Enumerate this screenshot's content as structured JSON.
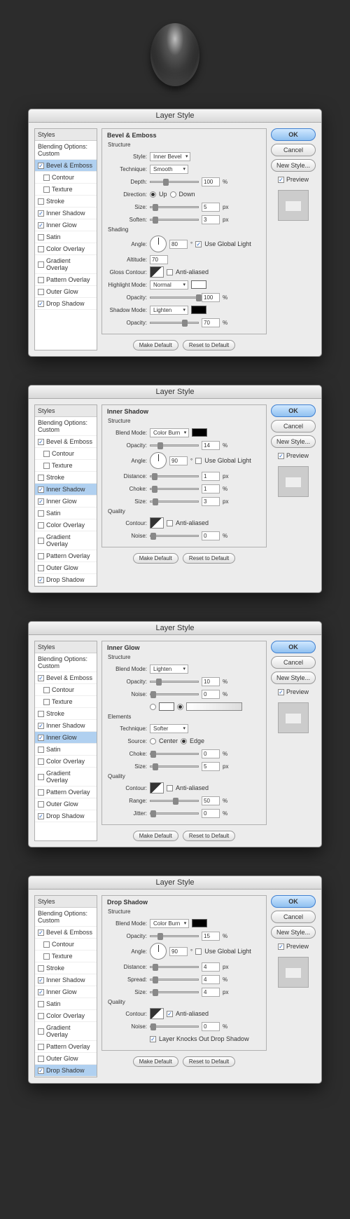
{
  "dialog_title": "Layer Style",
  "buttons": {
    "ok": "OK",
    "cancel": "Cancel",
    "new_style": "New Style...",
    "preview": "Preview",
    "make_default": "Make Default",
    "reset_default": "Reset to Default"
  },
  "styles_panel": {
    "header": "Styles",
    "blending": "Blending Options: Custom",
    "items": [
      {
        "label": "Bevel & Emboss",
        "checked": true
      },
      {
        "label": "Contour",
        "checked": false,
        "indent": true
      },
      {
        "label": "Texture",
        "checked": false,
        "indent": true
      },
      {
        "label": "Stroke",
        "checked": false
      },
      {
        "label": "Inner Shadow",
        "checked": true
      },
      {
        "label": "Inner Glow",
        "checked": true
      },
      {
        "label": "Satin",
        "checked": false
      },
      {
        "label": "Color Overlay",
        "checked": false
      },
      {
        "label": "Gradient Overlay",
        "checked": false
      },
      {
        "label": "Pattern Overlay",
        "checked": false
      },
      {
        "label": "Outer Glow",
        "checked": false
      },
      {
        "label": "Drop Shadow",
        "checked": true
      }
    ]
  },
  "panels": [
    {
      "title": "Bevel & Emboss",
      "selected": "Bevel & Emboss",
      "sections": [
        {
          "title": "Structure",
          "rows": [
            {
              "type": "select",
              "label": "Style:",
              "value": "Inner Bevel"
            },
            {
              "type": "select",
              "label": "Technique:",
              "value": "Smooth"
            },
            {
              "type": "slider",
              "label": "Depth:",
              "value": "100",
              "unit": "%",
              "pos": 18
            },
            {
              "type": "radio2",
              "label": "Direction:",
              "opt1": "Up",
              "opt2": "Down",
              "sel": 1
            },
            {
              "type": "slider",
              "label": "Size:",
              "value": "5",
              "unit": "px",
              "pos": 3
            },
            {
              "type": "slider",
              "label": "Soften:",
              "value": "3",
              "unit": "px",
              "pos": 3
            }
          ]
        },
        {
          "title": "Shading",
          "rows": [
            {
              "type": "angle",
              "label": "Angle:",
              "value": "80",
              "global": true,
              "global_label": "Use Global Light"
            },
            {
              "type": "num",
              "label": "Altitude:",
              "value": "70"
            },
            {
              "type": "contour",
              "label": "Gloss Contour:",
              "anti": "Anti-aliased",
              "checked": false
            },
            {
              "type": "blend",
              "label": "Highlight Mode:",
              "value": "Normal",
              "swatch": "white"
            },
            {
              "type": "slider",
              "label": "Opacity:",
              "value": "100",
              "unit": "%",
              "pos": 65
            },
            {
              "type": "blend",
              "label": "Shadow Mode:",
              "value": "Lighten",
              "swatch": "black"
            },
            {
              "type": "slider",
              "label": "Opacity:",
              "value": "70",
              "unit": "%",
              "pos": 45
            }
          ]
        }
      ]
    },
    {
      "title": "Inner Shadow",
      "selected": "Inner Shadow",
      "sections": [
        {
          "title": "Structure",
          "rows": [
            {
              "type": "blend",
              "label": "Blend Mode:",
              "value": "Color Burn",
              "swatch": "black"
            },
            {
              "type": "slider",
              "label": "Opacity:",
              "value": "14",
              "unit": "%",
              "pos": 10
            },
            {
              "type": "angle",
              "label": "Angle:",
              "value": "90",
              "global": false,
              "global_label": "Use Global Light"
            },
            {
              "type": "slider",
              "label": "Distance:",
              "value": "1",
              "unit": "px",
              "pos": 2
            },
            {
              "type": "slider",
              "label": "Choke:",
              "value": "1",
              "unit": "%",
              "pos": 2
            },
            {
              "type": "slider",
              "label": "Size:",
              "value": "3",
              "unit": "px",
              "pos": 3
            }
          ]
        },
        {
          "title": "Quality",
          "rows": [
            {
              "type": "contour",
              "label": "Contour:",
              "anti": "Anti-aliased",
              "checked": false
            },
            {
              "type": "slider",
              "label": "Noise:",
              "value": "0",
              "unit": "%",
              "pos": 0
            }
          ]
        }
      ]
    },
    {
      "title": "Inner Glow",
      "selected": "Inner Glow",
      "sections": [
        {
          "title": "Structure",
          "rows": [
            {
              "type": "blend",
              "label": "Blend Mode:",
              "value": "Lighten"
            },
            {
              "type": "slider",
              "label": "Opacity:",
              "value": "10",
              "unit": "%",
              "pos": 8
            },
            {
              "type": "slider",
              "label": "Noise:",
              "value": "0",
              "unit": "%",
              "pos": 0
            },
            {
              "type": "color_gradient"
            }
          ]
        },
        {
          "title": "Elements",
          "rows": [
            {
              "type": "select",
              "label": "Technique:",
              "value": "Softer"
            },
            {
              "type": "radio2",
              "label": "Source:",
              "opt1": "Center",
              "opt2": "Edge",
              "sel": 2
            },
            {
              "type": "slider",
              "label": "Choke:",
              "value": "0",
              "unit": "%",
              "pos": 0
            },
            {
              "type": "slider",
              "label": "Size:",
              "value": "5",
              "unit": "px",
              "pos": 3
            }
          ]
        },
        {
          "title": "Quality",
          "rows": [
            {
              "type": "contour",
              "label": "Contour:",
              "anti": "Anti-aliased",
              "checked": false
            },
            {
              "type": "slider",
              "label": "Range:",
              "value": "50",
              "unit": "%",
              "pos": 32
            },
            {
              "type": "slider",
              "label": "Jitter:",
              "value": "0",
              "unit": "%",
              "pos": 0
            }
          ]
        }
      ]
    },
    {
      "title": "Drop Shadow",
      "selected": "Drop Shadow",
      "sections": [
        {
          "title": "Structure",
          "rows": [
            {
              "type": "blend",
              "label": "Blend Mode:",
              "value": "Color Burn",
              "swatch": "black"
            },
            {
              "type": "slider",
              "label": "Opacity:",
              "value": "15",
              "unit": "%",
              "pos": 10
            },
            {
              "type": "angle",
              "label": "Angle:",
              "value": "90",
              "global": false,
              "global_label": "Use Global Light"
            },
            {
              "type": "slider",
              "label": "Distance:",
              "value": "4",
              "unit": "px",
              "pos": 3
            },
            {
              "type": "slider",
              "label": "Spread:",
              "value": "4",
              "unit": "%",
              "pos": 3
            },
            {
              "type": "slider",
              "label": "Size:",
              "value": "4",
              "unit": "px",
              "pos": 3
            }
          ]
        },
        {
          "title": "Quality",
          "rows": [
            {
              "type": "contour",
              "label": "Contour:",
              "anti": "Anti-aliased",
              "checked": true
            },
            {
              "type": "slider",
              "label": "Noise:",
              "value": "0",
              "unit": "%",
              "pos": 0
            },
            {
              "type": "knockout",
              "label": "Layer Knocks Out Drop Shadow",
              "checked": true
            }
          ]
        }
      ]
    }
  ]
}
